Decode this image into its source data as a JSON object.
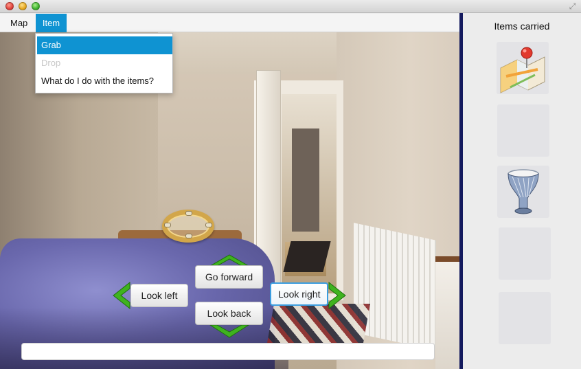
{
  "window": {
    "fullscreen_icon": "fullscreen-arrows-icon"
  },
  "menubar": {
    "map_label": "Map",
    "item_label": "Item"
  },
  "item_menu": {
    "grab_label": "Grab",
    "drop_label": "Drop",
    "help_label": "What do I do with the items?"
  },
  "navigation": {
    "forward_label": "Go forward",
    "left_label": "Look left",
    "right_label": "Look right",
    "back_label": "Look back",
    "arrow_color": "#3fb31f"
  },
  "status": {
    "value": ""
  },
  "inventory": {
    "title": "Items carried",
    "slots": [
      {
        "icon": "map-pin-icon"
      },
      {
        "icon": ""
      },
      {
        "icon": "drum-icon"
      },
      {
        "icon": ""
      },
      {
        "icon": ""
      }
    ]
  },
  "scene": {
    "object_icon": "tambourine-icon"
  },
  "colors": {
    "accent": "#0f93d2",
    "divider": "#141a5e"
  }
}
